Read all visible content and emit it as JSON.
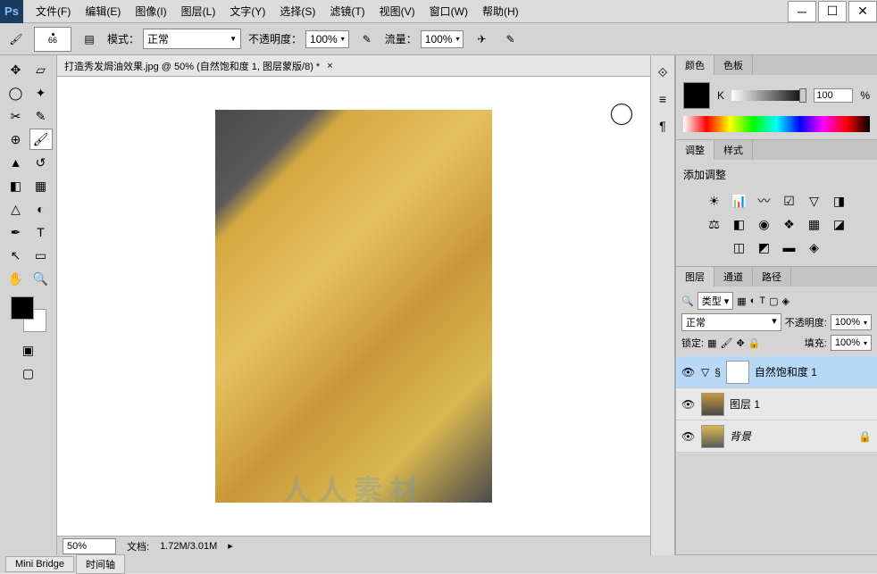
{
  "menu": {
    "file": "文件(F)",
    "edit": "编辑(E)",
    "image": "图像(I)",
    "layer": "图层(L)",
    "type": "文字(Y)",
    "select": "选择(S)",
    "filter": "滤镜(T)",
    "view": "视图(V)",
    "window": "窗口(W)",
    "help": "帮助(H)"
  },
  "options": {
    "brush_size": "66",
    "mode_label": "模式：",
    "mode_value": "正常",
    "opacity_label": "不透明度：",
    "opacity_value": "100%",
    "flow_label": "流量：",
    "flow_value": "100%"
  },
  "document": {
    "tab_title": "打造秀发焗油效果.jpg @ 50% (自然饱和度 1, 图层蒙版/8) *",
    "zoom": "50%",
    "doc_info_label": "文档:",
    "doc_info": "1.72M/3.01M"
  },
  "bottom_tabs": {
    "mini_bridge": "Mini Bridge",
    "timeline": "时间轴"
  },
  "color_panel": {
    "tab_color": "颜色",
    "tab_swatch": "色板",
    "channel": "K",
    "value": "100",
    "unit": "%"
  },
  "adjust_panel": {
    "tab_adjust": "调整",
    "tab_style": "样式",
    "title": "添加调整"
  },
  "layers_panel": {
    "tab_layers": "图层",
    "tab_channels": "通道",
    "tab_paths": "路径",
    "filter_type": "类型",
    "blend_mode": "正常",
    "opacity_label": "不透明度:",
    "opacity_value": "100%",
    "lock_label": "锁定:",
    "fill_label": "填充:",
    "fill_value": "100%",
    "layers": [
      {
        "name": "自然饱和度 1",
        "active": true,
        "thumb": "mask"
      },
      {
        "name": "图层 1",
        "active": false,
        "thumb": "img1"
      },
      {
        "name": "背景",
        "active": false,
        "thumb": "img2",
        "locked": true
      }
    ]
  },
  "watermark": "人人素材"
}
